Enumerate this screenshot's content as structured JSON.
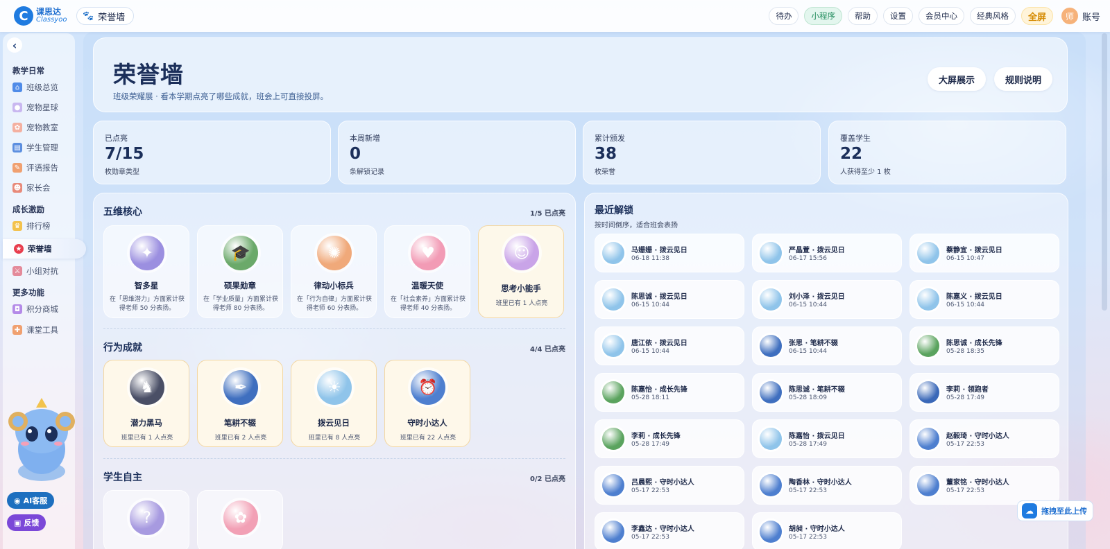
{
  "brand": {
    "logo_cn": "课思达",
    "logo_en": "Classyoo"
  },
  "topbar": {
    "page_chip": "荣誉墙",
    "nav": [
      "待办",
      "小程序",
      "帮助",
      "设置",
      "会员中心",
      "经典风格"
    ],
    "fullscreen": "全屏",
    "avatar": "师",
    "account": "账号"
  },
  "sidebar": {
    "sections": [
      {
        "title": "教学日常",
        "items": [
          "班级总览",
          "宠物星球",
          "宠物教室",
          "学生管理",
          "评语报告",
          "家长会"
        ]
      },
      {
        "title": "成长激励",
        "items": [
          "排行榜",
          "荣誉墙",
          "小组对抗"
        ]
      },
      {
        "title": "更多功能",
        "items": [
          "积分商城",
          "课堂工具"
        ]
      }
    ],
    "active": "荣誉墙",
    "ai_label": "AI客服",
    "feedback_label": "反馈"
  },
  "hero": {
    "title": "荣誉墙",
    "subtitle": "班级荣耀展 · 看本学期点亮了哪些成就，班会上可直接投屏。",
    "btn_big": "大屏展示",
    "btn_rules": "规则说明"
  },
  "stats": [
    {
      "label": "已点亮",
      "value": "7/15",
      "note": "枚勋章类型"
    },
    {
      "label": "本周新增",
      "value": "0",
      "note": "条解锁记录"
    },
    {
      "label": "累计颁发",
      "value": "38",
      "note": "枚荣誉"
    },
    {
      "label": "覆盖学生",
      "value": "22",
      "note": "人获得至少 1 枚"
    }
  ],
  "groups": [
    {
      "title": "五维核心",
      "meta": "1/5 已点亮",
      "badges": [
        {
          "name": "智多星",
          "desc": "在「思维潜力」方面累计获得老师 50 分表扬。",
          "lit": false,
          "icon": "brain-icon",
          "color": "#9b8fe0",
          "glyph": "✦"
        },
        {
          "name": "硕果勋章",
          "desc": "在「学业质量」方面累计获得老师 80 分表扬。",
          "lit": false,
          "icon": "graduation-cap-icon",
          "color": "#6ba96a",
          "glyph": "🎓"
        },
        {
          "name": "律动小标兵",
          "desc": "在「行为自律」方面累计获得老师 60 分表扬。",
          "lit": false,
          "icon": "runner-icon",
          "color": "#f0a97a",
          "glyph": "✺"
        },
        {
          "name": "温暖天使",
          "desc": "在「社会素养」方面累计获得老师 40 分表扬。",
          "lit": false,
          "icon": "heart-icon",
          "color": "#f29bb5",
          "glyph": "♥"
        },
        {
          "name": "思考小能手",
          "desc": "班里已有 1 人点亮",
          "lit": true,
          "icon": "thinking-kid-icon",
          "color": "#c9a4e8",
          "glyph": "☺"
        }
      ]
    },
    {
      "title": "行为成就",
      "meta": "4/4 已点亮",
      "badges": [
        {
          "name": "潜力黑马",
          "desc": "班里已有 1 人点亮",
          "lit": true,
          "icon": "horse-icon",
          "color": "#4a4f66",
          "glyph": "♞"
        },
        {
          "name": "笔耕不辍",
          "desc": "班里已有 2 人点亮",
          "lit": true,
          "icon": "pen-icon",
          "color": "#3f6fbf",
          "glyph": "✒"
        },
        {
          "name": "拨云见日",
          "desc": "班里已有 8 人点亮",
          "lit": true,
          "icon": "sun-cloud-icon",
          "color": "#8fc4ea",
          "glyph": "☀"
        },
        {
          "name": "守时小达人",
          "desc": "班里已有 22 人点亮",
          "lit": true,
          "icon": "alarm-clock-icon",
          "color": "#4e7fcf",
          "glyph": "⏰"
        }
      ]
    },
    {
      "title": "学生自主",
      "meta": "0/2 已点亮",
      "badges": [
        {
          "name": "",
          "desc": "",
          "lit": false,
          "icon": "question-book-icon",
          "color": "#a79ae0",
          "glyph": "?"
        },
        {
          "name": "",
          "desc": "",
          "lit": false,
          "icon": "pig-icon",
          "color": "#f2a0b5",
          "glyph": "✿"
        }
      ]
    }
  ],
  "recent": {
    "title": "最近解锁",
    "subtitle": "按时间倒序，适合班会表扬",
    "items": [
      {
        "text": "马姗姗 · 拨云见日",
        "time": "06-18 11:38",
        "icon": "sun-cloud-icon",
        "color": "#8fc4ea"
      },
      {
        "text": "严晶萱 · 拨云见日",
        "time": "06-17 15:56",
        "icon": "sun-cloud-icon",
        "color": "#8fc4ea"
      },
      {
        "text": "蔡静宜 · 拨云见日",
        "time": "06-15 10:47",
        "icon": "sun-cloud-icon",
        "color": "#8fc4ea"
      },
      {
        "text": "陈思诚 · 拨云见日",
        "time": "06-15 10:44",
        "icon": "sun-cloud-icon",
        "color": "#8fc4ea"
      },
      {
        "text": "刘小泽 · 拨云见日",
        "time": "06-15 10:44",
        "icon": "sun-cloud-icon",
        "color": "#8fc4ea"
      },
      {
        "text": "陈嘉义 · 拨云见日",
        "time": "06-15 10:44",
        "icon": "sun-cloud-icon",
        "color": "#8fc4ea"
      },
      {
        "text": "唐江依 · 拨云见日",
        "time": "06-15 10:44",
        "icon": "sun-cloud-icon",
        "color": "#8fc4ea"
      },
      {
        "text": "张思 · 笔耕不辍",
        "time": "06-15 10:44",
        "icon": "pen-icon",
        "color": "#3f6fbf"
      },
      {
        "text": "陈思诚 · 成长先锋",
        "time": "05-28 18:35",
        "icon": "sprout-icon",
        "color": "#5aa35e"
      },
      {
        "text": "陈嘉怡 · 成长先锋",
        "time": "05-28 18:11",
        "icon": "sprout-icon",
        "color": "#5aa35e"
      },
      {
        "text": "陈思诚 · 笔耕不辍",
        "time": "05-28 18:09",
        "icon": "pen-icon",
        "color": "#3f6fbf"
      },
      {
        "text": "李莉 · 领跑者",
        "time": "05-28 17:49",
        "icon": "trophy-icon",
        "color": "#3a68b8"
      },
      {
        "text": "李莉 · 成长先锋",
        "time": "05-28 17:49",
        "icon": "sprout-icon",
        "color": "#5aa35e"
      },
      {
        "text": "陈嘉怡 · 拨云见日",
        "time": "05-28 17:49",
        "icon": "sun-cloud-icon",
        "color": "#8fc4ea"
      },
      {
        "text": "赵毅琦 · 守时小达人",
        "time": "05-17 22:53",
        "icon": "alarm-clock-icon",
        "color": "#4e7fcf"
      },
      {
        "text": "吕晨熙 · 守时小达人",
        "time": "05-17 22:53",
        "icon": "alarm-clock-icon",
        "color": "#4e7fcf"
      },
      {
        "text": "陶香林 · 守时小达人",
        "time": "05-17 22:53",
        "icon": "alarm-clock-icon",
        "color": "#4e7fcf"
      },
      {
        "text": "董家铭 · 守时小达人",
        "time": "05-17 22:53",
        "icon": "alarm-clock-icon",
        "color": "#4e7fcf"
      },
      {
        "text": "李鑫达 · 守时小达人",
        "time": "05-17 22:53",
        "icon": "alarm-clock-icon",
        "color": "#4e7fcf"
      },
      {
        "text": "胡昶 · 守时小达人",
        "time": "05-17 22:53",
        "icon": "alarm-clock-icon",
        "color": "#4e7fcf"
      }
    ]
  },
  "upload": {
    "label": "拖拽至此上传",
    "icon": "cloud-upload-icon"
  }
}
